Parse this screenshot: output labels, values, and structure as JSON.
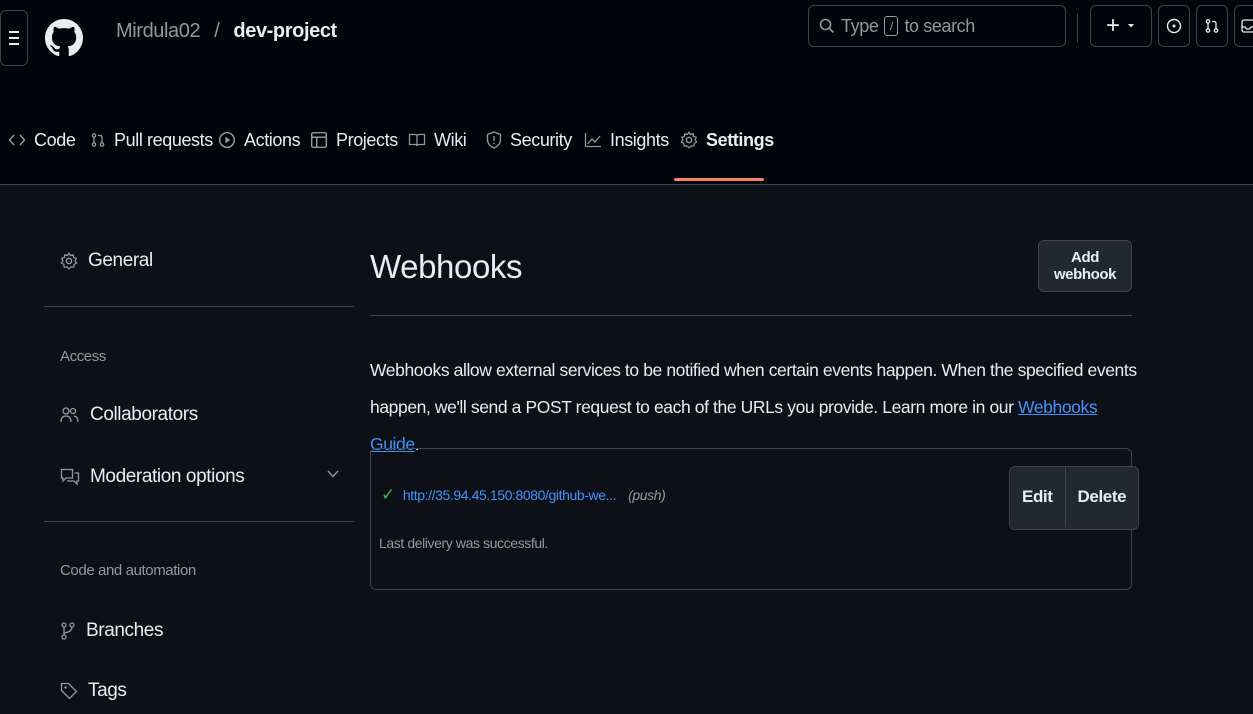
{
  "header": {
    "owner": "Mirdula02",
    "separator": "/",
    "repo": "dev-project",
    "search_prefix": "Type",
    "search_key": "/",
    "search_suffix": "to search",
    "create_label": "+"
  },
  "nav": {
    "tabs": [
      {
        "label": "Code",
        "icon": "code-icon"
      },
      {
        "label": "Pull requests",
        "icon": "pull-request-icon"
      },
      {
        "label": "Actions",
        "icon": "play-icon"
      },
      {
        "label": "Projects",
        "icon": "table-icon"
      },
      {
        "label": "Wiki",
        "icon": "book-icon"
      },
      {
        "label": "Security",
        "icon": "shield-icon"
      },
      {
        "label": "Insights",
        "icon": "graph-icon"
      },
      {
        "label": "Settings",
        "icon": "gear-icon",
        "active": true
      }
    ]
  },
  "sidebar": {
    "general": "General",
    "access_heading": "Access",
    "collaborators": "Collaborators",
    "moderation": "Moderation options",
    "code_heading": "Code and automation",
    "branches": "Branches",
    "tags": "Tags"
  },
  "main": {
    "title": "Webhooks",
    "add_button": "Add webhook",
    "description": "Webhooks allow external services to be notified when certain events happen. When the specified events happen, we'll send a POST request to each of the URLs you provide. Learn more in our ",
    "guide_link": "Webhooks Guide",
    "description_end": ".",
    "webhook": {
      "url": "http://35.94.45.150:8080/github-we...",
      "event": "(push)",
      "status": "Last delivery was successful.",
      "edit": "Edit",
      "delete": "Delete"
    }
  },
  "colors": {
    "background": "#0d1117",
    "header": "#010409",
    "border": "#3d444d",
    "accent_underline": "#f78166",
    "link": "#4493f8",
    "success": "#3fb950"
  }
}
